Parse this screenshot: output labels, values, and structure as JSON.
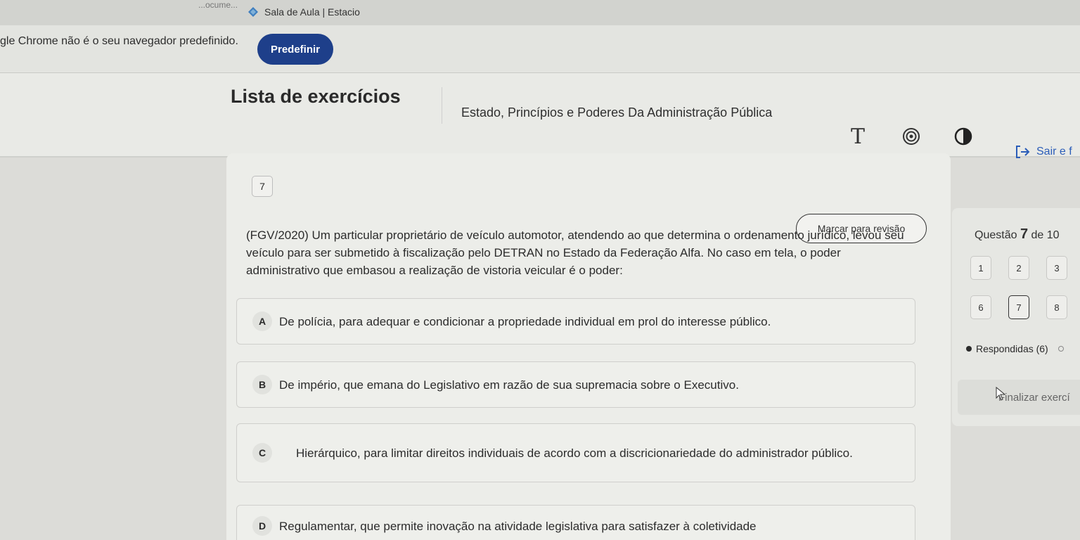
{
  "browser": {
    "prev_tab_fragment": "...ocume...",
    "active_tab_title": "Sala de Aula | Estacio",
    "infobar_text": "gle Chrome não é o seu navegador predefinido.",
    "infobar_button": "Predefinir"
  },
  "header": {
    "title": "Lista de exercícios",
    "subtitle": "Estado, Princípios e Poderes Da Administração Pública",
    "font_icon_glyph": "T",
    "exit_label": "Sair e f"
  },
  "question": {
    "number": "7",
    "review_button": "Marcar para revisão",
    "text": "(FGV/2020) Um particular proprietário de veículo automotor, atendendo ao que determina o ordenamento jurídico, levou seu veículo para ser submetido à fiscalização pelo DETRAN no Estado da Federação Alfa. No caso em tela, o poder administrativo que embasou a realização de vistoria veicular é o poder:",
    "options": [
      {
        "letter": "A",
        "text": "De polícia, para adequar e condicionar a propriedade individual em prol do interesse público."
      },
      {
        "letter": "B",
        "text": "De império, que emana do Legislativo em razão de sua supremacia sobre o Executivo."
      },
      {
        "letter": "C",
        "text": "Hierárquico, para limitar direitos individuais de acordo com a discricionariedade do administrador público."
      },
      {
        "letter": "D",
        "text": "Regulamentar, que permite inovação na atividade legislativa para satisfazer à coletividade"
      }
    ]
  },
  "nav": {
    "label_prefix": "Questão",
    "current": "7",
    "label_suffix": "de 10",
    "buttons": [
      "1",
      "2",
      "3",
      "6",
      "7",
      "8"
    ],
    "answered_label": "Respondidas (6)",
    "finish_label": "Finalizar exercí"
  }
}
